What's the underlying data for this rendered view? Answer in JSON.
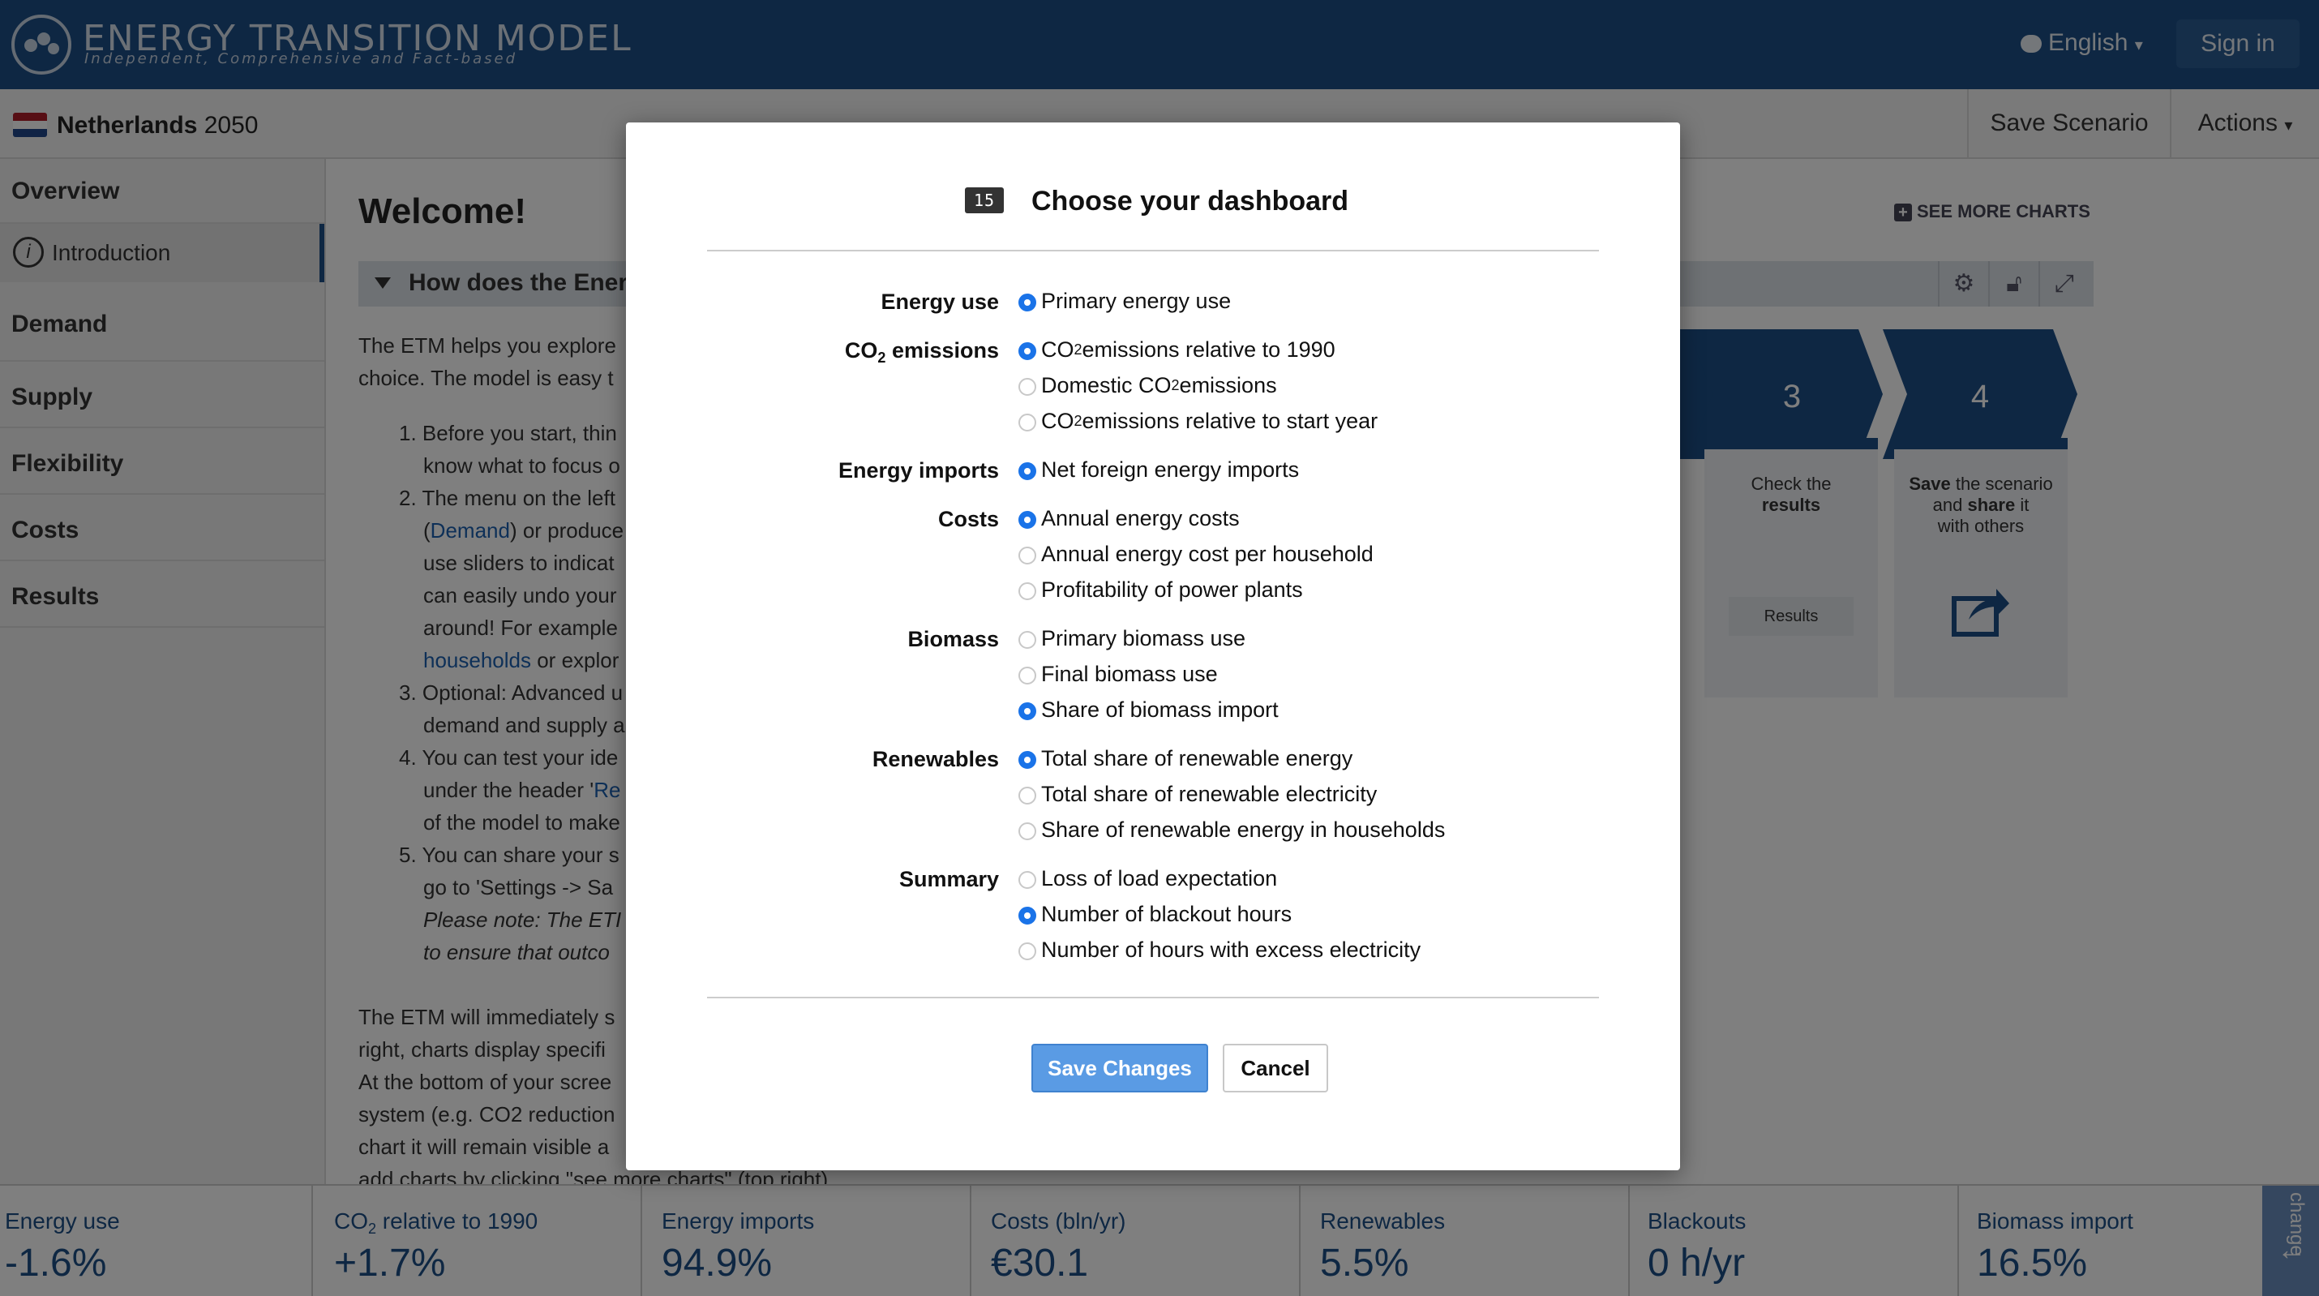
{
  "header": {
    "logo_title": "ENERGY TRANSITION MODEL",
    "logo_subtitle": "Independent, Comprehensive and Fact-based",
    "language": "English",
    "signin": "Sign in"
  },
  "scenario": {
    "country": "Netherlands",
    "year": "2050",
    "save": "Save Scenario",
    "actions": "Actions"
  },
  "menu": {
    "overview": "Overview",
    "introduction": "Introduction",
    "demand": "Demand",
    "supply": "Supply",
    "flexibility": "Flexibility",
    "costs": "Costs",
    "results": "Results"
  },
  "content": {
    "welcome": "Welcome!",
    "accordion": "How does the Energ",
    "see_more": "SEE MORE CHARTS",
    "lines": [
      "The ETM helps you explore",
      "choice. The model is easy t",
      "1. Before you start, thin",
      "know what to focus o",
      "2. The menu on the left",
      "(Demand) or produce",
      "use sliders to indicat",
      "can easily undo your",
      "around! For example",
      "households or explor",
      "3. Optional: Advanced u",
      "demand and supply a",
      "4. You can test your ide",
      "under the header 'Re",
      "of the model to make",
      "5. You can share your s",
      "go to 'Settings -> Sa",
      "Please note: The ETI",
      "to ensure that outco",
      "The ETM will immediately s",
      "right, charts display specifi",
      "At the bottom of your scree",
      "system (e.g. CO2 reduction",
      "chart it will remain visible a",
      "add charts by clicking \"see more charts\" (top right)."
    ],
    "demand_link": "Demand",
    "households_link": "households",
    "results_link": "Re",
    "steps": {
      "step3": "3",
      "step4": "4",
      "step3_text1": "Check the",
      "step3_text2": "results",
      "step3_button": "Results",
      "step4_text1": "Save",
      "step4_text2": "the scenario",
      "step4_text3": "and",
      "step4_text4": "share",
      "step4_text5": "it",
      "step4_text6": "with others"
    }
  },
  "dashboard": [
    {
      "label": "Energy use",
      "value": "-1.6%"
    },
    {
      "label": "CO2 relative to 1990",
      "value": "+1.7%"
    },
    {
      "label": "Energy imports",
      "value": "94.9%"
    },
    {
      "label": "Costs (bln/yr)",
      "value": "€30.1"
    },
    {
      "label": "Renewables",
      "value": "5.5%"
    },
    {
      "label": "Blackouts",
      "value": "0 h/yr"
    },
    {
      "label": "Biomass import",
      "value": "16.5%"
    }
  ],
  "change_tab": "change",
  "modal": {
    "title": "Choose your dashboard",
    "icon_text": "15",
    "groups": {
      "energy_use": "Energy use",
      "co2_pre": "CO",
      "co2_sub": "2",
      "co2_post": " emissions",
      "energy_imports": "Energy imports",
      "costs": "Costs",
      "biomass": "Biomass",
      "renewables": "Renewables",
      "summary": "Summary"
    },
    "options": {
      "primary_energy_use": "Primary energy use",
      "co2_1990_pre": "CO",
      "co2_1990_sub": "2",
      "co2_1990_post": " emissions relative to 1990",
      "co2_domestic_pre": "Domestic CO",
      "co2_domestic_sub": "2",
      "co2_domestic_post": " emissions",
      "co2_start_pre": "CO",
      "co2_start_sub": "2",
      "co2_start_post": " emissions relative to start year",
      "net_foreign_imports": "Net foreign energy imports",
      "annual_energy_costs": "Annual energy costs",
      "annual_cost_household": "Annual energy cost per household",
      "profitability_plants": "Profitability of power plants",
      "primary_biomass": "Primary biomass use",
      "final_biomass": "Final biomass use",
      "share_biomass_import": "Share of biomass import",
      "total_share_renewable": "Total share of renewable energy",
      "total_share_renewable_elec": "Total share of renewable electricity",
      "share_renewable_households": "Share of renewable energy in households",
      "loss_of_load": "Loss of load expectation",
      "blackout_hours": "Number of blackout hours",
      "excess_hours": "Number of hours with excess electricity"
    },
    "save": "Save Changes",
    "cancel": "Cancel"
  }
}
